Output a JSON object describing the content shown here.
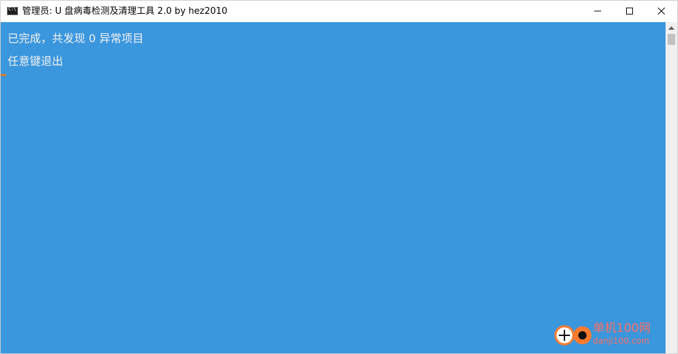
{
  "window": {
    "title": "管理员:  U 盘病毒检测及清理工具 2.0 by hez2010",
    "icon": "cmd-icon",
    "buttons": [
      "minimize-icon",
      "maximize-icon",
      "close-icon"
    ]
  },
  "console": {
    "lines": [
      "已完成，共发现 0 异常项目",
      "任意键退出"
    ],
    "background": "#3a96dd",
    "foreground": "#f2f2f2"
  },
  "scrollbar": {
    "background": "#f0f0f0",
    "thumb": "#c2c2c2"
  },
  "watermark": {
    "text": "单机100网",
    "subtext": "danji100.com",
    "color": "#ff6f61"
  }
}
